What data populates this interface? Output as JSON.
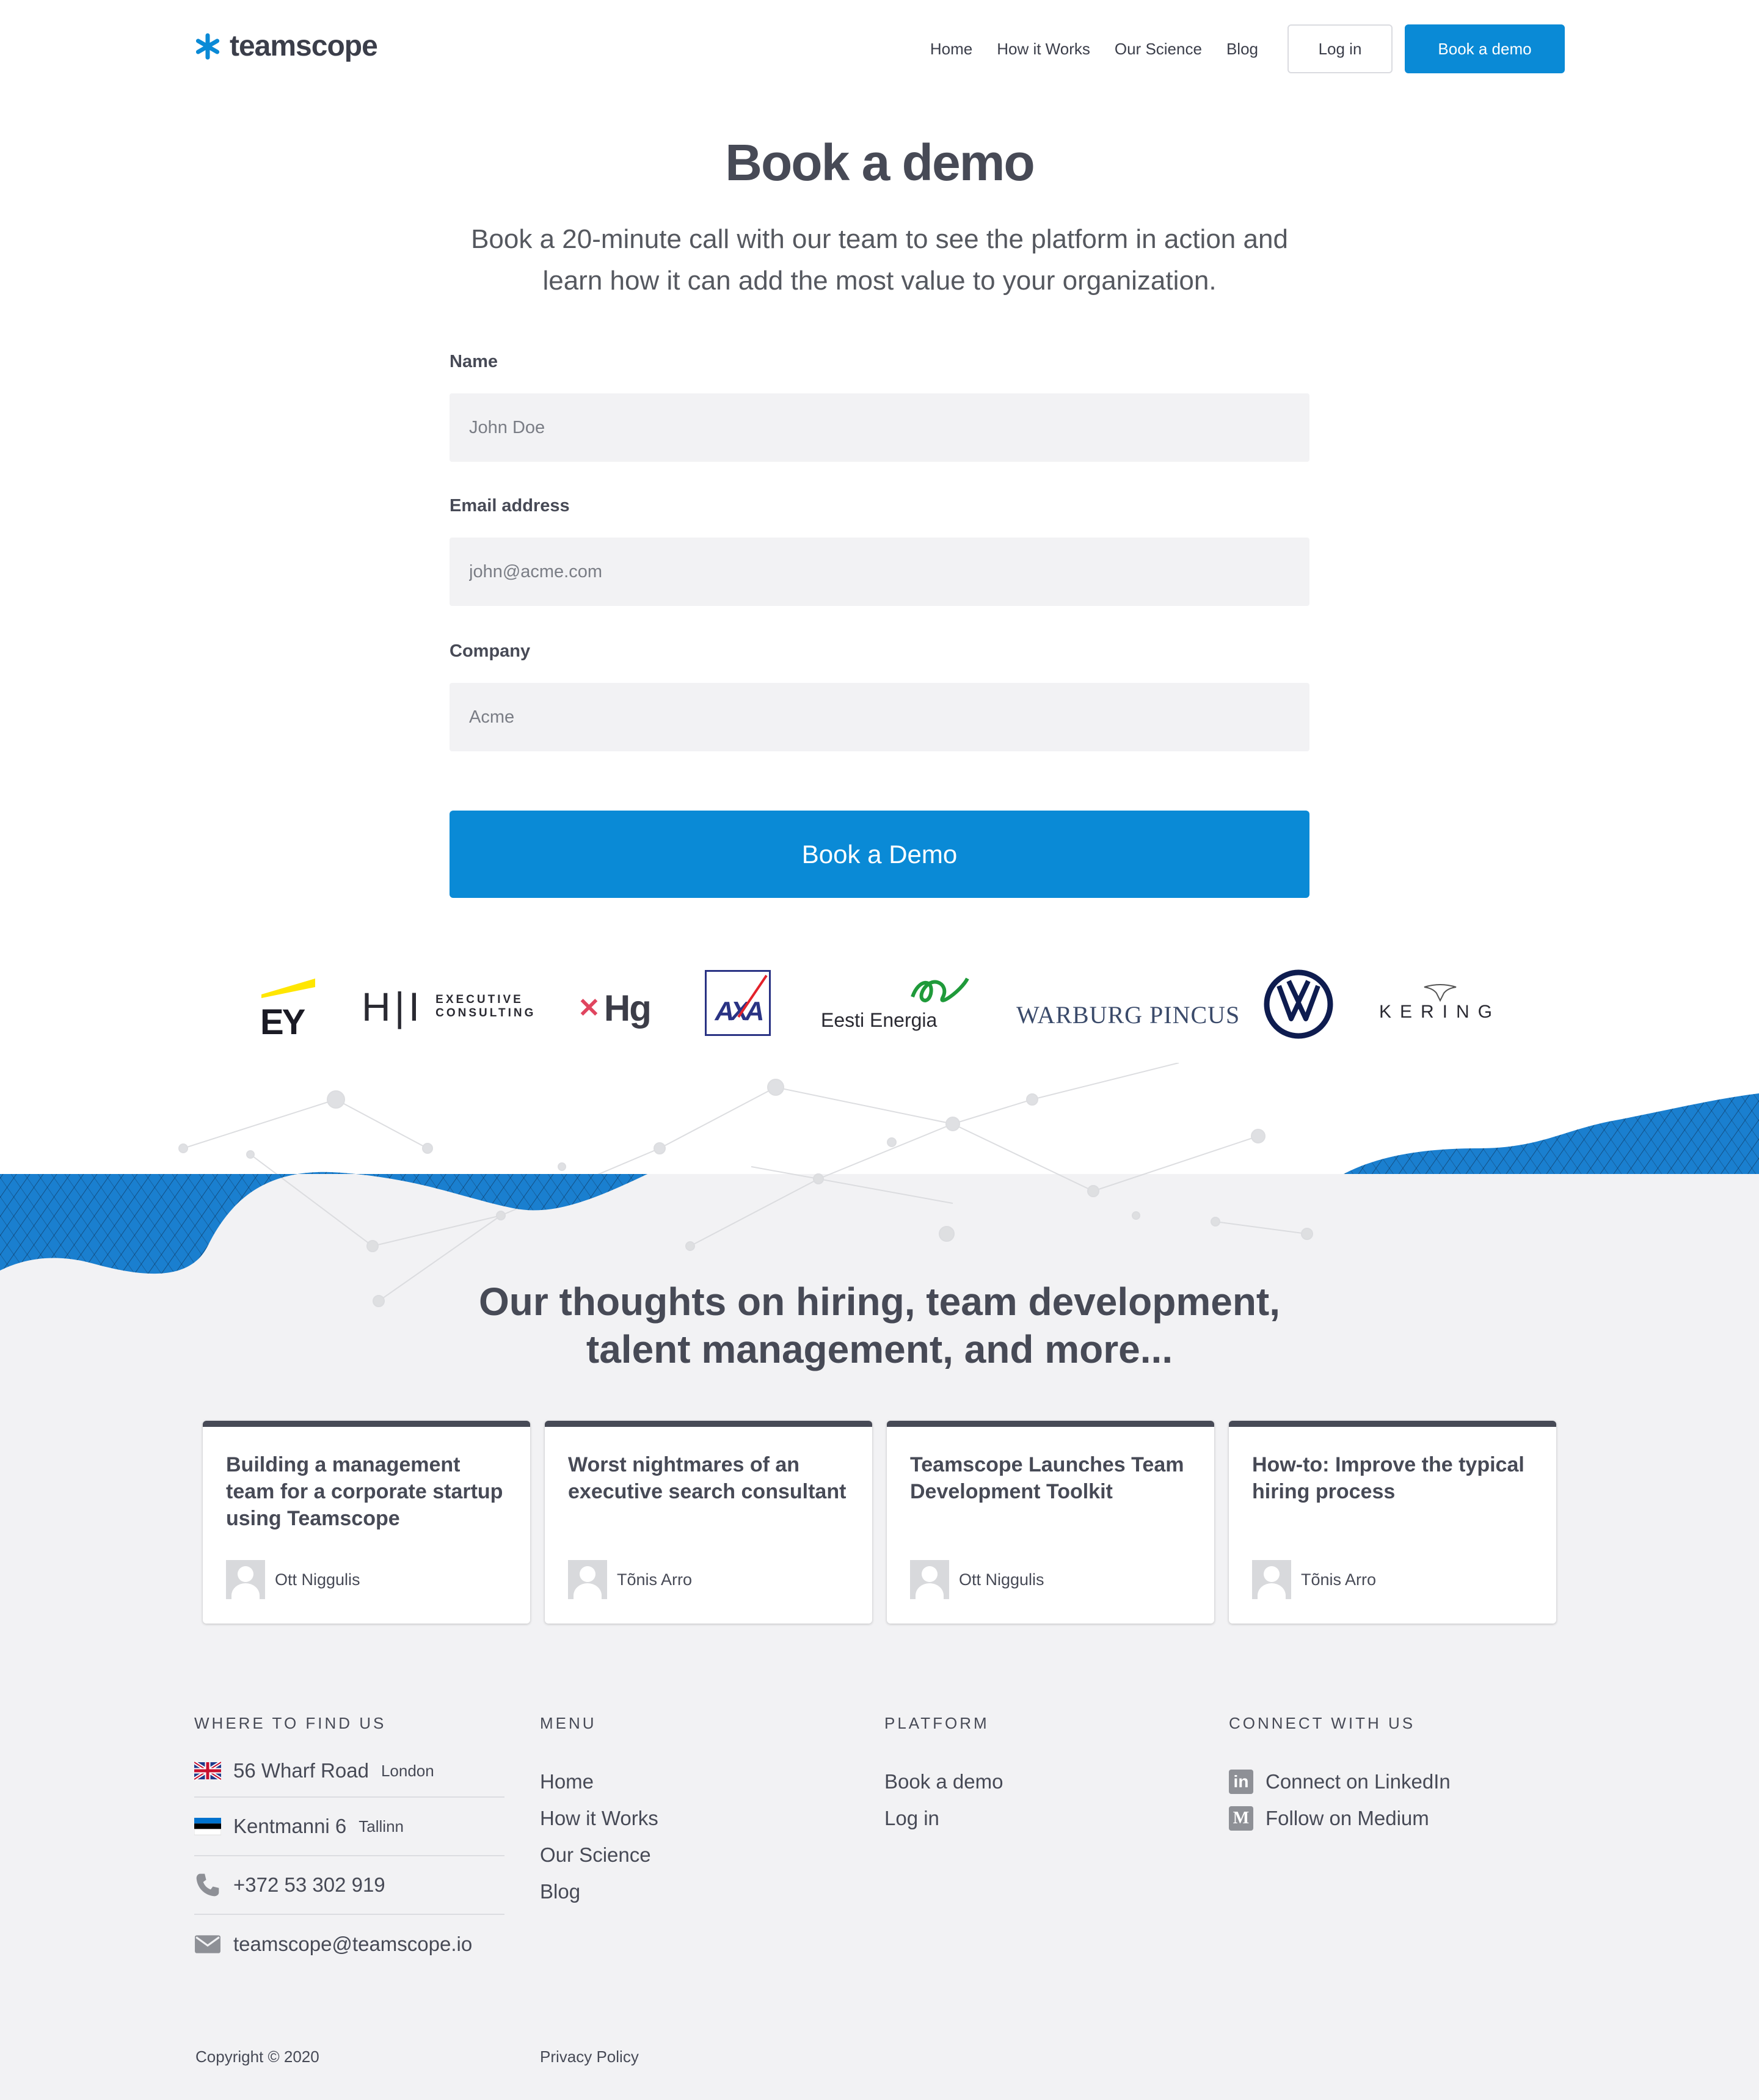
{
  "header": {
    "brand": "teamscope",
    "nav": [
      "Home",
      "How it Works",
      "Our Science",
      "Blog"
    ],
    "login_label": "Log in",
    "demo_label": "Book a demo"
  },
  "hero": {
    "title": "Book a demo",
    "subtitle": "Book a 20-minute call with our team to see the platform in action and learn how it can add the most value to your organization."
  },
  "form": {
    "name_label": "Name",
    "name_placeholder": "John Doe",
    "email_label": "Email address",
    "email_placeholder": "john@acme.com",
    "company_label": "Company",
    "company_placeholder": "Acme",
    "submit_label": "Book a Demo"
  },
  "clients": {
    "ey": "EY",
    "hi_mark": "H|I",
    "hi_text_1": "EXECUTIVE",
    "hi_text_2": "CONSULTING",
    "hg": "Hg",
    "axa": "AXA",
    "eesti": "Eesti Energia",
    "warburg": "WARBURG PINCUS",
    "kering": "KERING"
  },
  "blog": {
    "title_line1": "Our thoughts on hiring, team development,",
    "title_line2": "talent management, and more...",
    "posts": [
      {
        "title": "Building a management team for a corporate startup using Teamscope",
        "author": "Ott Niggulis"
      },
      {
        "title": "Worst nightmares of an executive search consultant",
        "author": "Tõnis Arro"
      },
      {
        "title": "Teamscope Launches Team Development Toolkit",
        "author": "Ott Niggulis"
      },
      {
        "title": "How-to: Improve the typical hiring process",
        "author": "Tõnis Arro"
      }
    ]
  },
  "footer": {
    "find_us_heading": "WHERE TO FIND US",
    "addresses": [
      {
        "main": "56 Wharf Road",
        "city": "London",
        "icon": "uk-flag-icon"
      },
      {
        "main": "Kentmanni 6",
        "city": "Tallinn",
        "icon": "estonia-flag-icon"
      },
      {
        "main": "+372 53 302 919",
        "city": "",
        "icon": "phone-icon"
      },
      {
        "main": "teamscope@teamscope.io",
        "city": "",
        "icon": "mail-icon"
      }
    ],
    "menu_heading": "MENU",
    "menu": [
      "Home",
      "How it Works",
      "Our Science",
      "Blog"
    ],
    "platform_heading": "PLATFORM",
    "platform": [
      "Book a demo",
      "Log in"
    ],
    "connect_heading": "CONNECT WITH US",
    "linkedin": "Connect on LinkedIn",
    "linkedin_icon": "in",
    "medium": "Follow on Medium",
    "medium_icon": "M",
    "copyright": "Copyright © 2020",
    "privacy": "Privacy Policy"
  },
  "colors": {
    "accent": "#0a8ad6",
    "text": "#474a56",
    "grey_bg": "#f2f2f4"
  }
}
